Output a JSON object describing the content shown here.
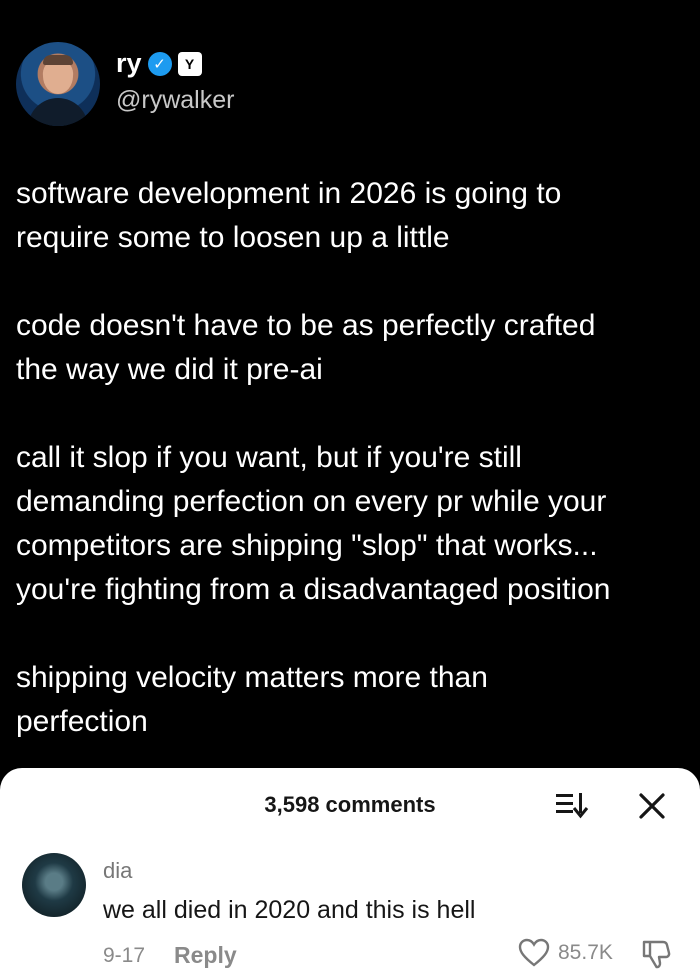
{
  "tweet": {
    "author_name": "ry",
    "handle": "@rywalker",
    "paragraphs": [
      "software development in 2026 is going to\nrequire some to loosen up a little",
      "code doesn't have to be as perfectly crafted\nthe way we did it pre-ai",
      "call it slop if you want, but if you're still\ndemanding perfection on every pr while your\ncompetitors are shipping \"slop\" that works...\nyou're fighting from a disadvantaged position",
      "shipping velocity matters more than\nperfection"
    ],
    "verified_icon": "verified-checkmark-icon",
    "brand_icon": "brand-badge-icon"
  },
  "comments_sheet": {
    "count_label": "3,598 comments",
    "comment": {
      "author": "dia",
      "text": "we all died in 2020 and this is hell",
      "date": "9-17",
      "reply_label": "Reply",
      "likes": "85.7K"
    }
  },
  "colors": {
    "background": "#000000",
    "verified": "#1d9bf0",
    "sheet": "#ffffff"
  }
}
